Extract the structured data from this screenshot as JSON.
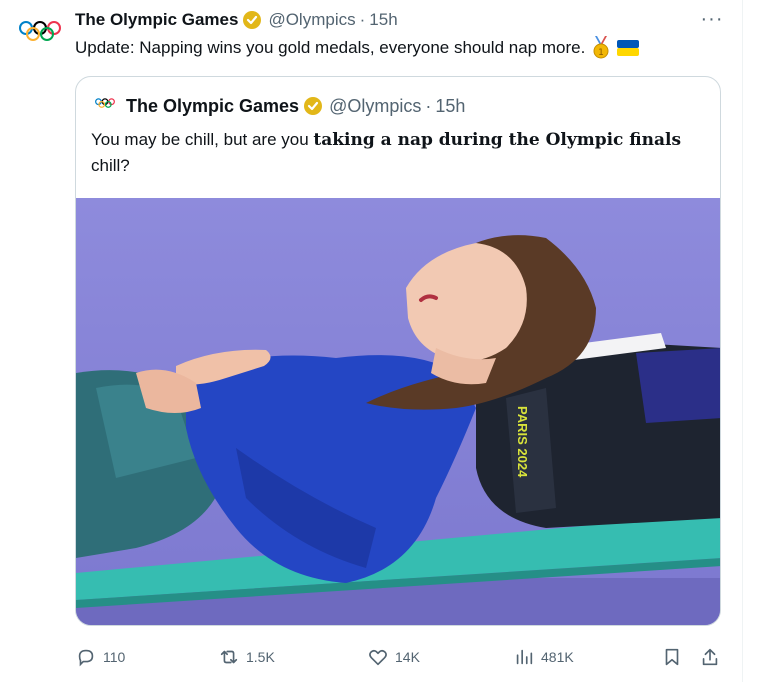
{
  "tweet": {
    "author": "The Olympic Games",
    "handle": "@Olympics",
    "separator": "·",
    "time": "15h",
    "text": "Update: Napping wins you gold medals, everyone should nap more.",
    "emojis": [
      "medal",
      "ukraine-flag"
    ]
  },
  "quoted": {
    "author": "The Olympic Games",
    "handle": "@Olympics",
    "separator": "·",
    "time": "15h",
    "text_prefix": "You may be chill, but are you ",
    "text_bold": "taking a nap during the Olympic finals",
    "text_suffix": " chill?",
    "photo_text": "PARIS 2024"
  },
  "actions": {
    "replies": "110",
    "reposts": "1.5K",
    "likes": "14K",
    "views": "481K"
  },
  "colors": {
    "text": "#0f1419",
    "muted": "#536471",
    "border": "#cfd9de",
    "verified": "#e2b719",
    "background_purple": "#8c89d9",
    "mat": "#33b7ad"
  }
}
